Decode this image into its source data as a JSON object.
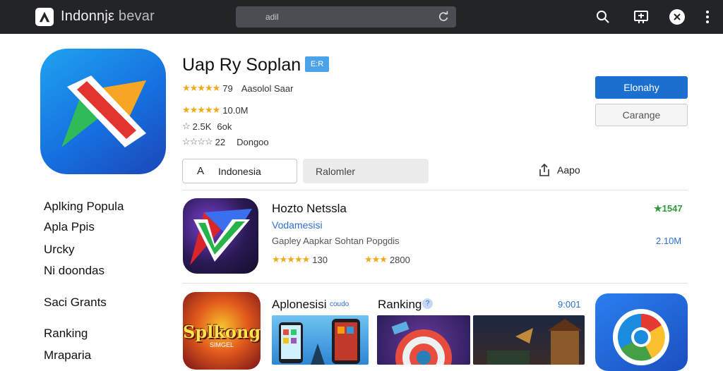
{
  "topbar": {
    "app_name_bold": "Indonnjε",
    "app_name_light": " bevar",
    "search_value": "adil",
    "icons": [
      "search-icon",
      "cast-icon",
      "profile-icon",
      "more-icon"
    ]
  },
  "hero": {
    "title": "Uap Ry Soplan",
    "badge": "E:R",
    "rating_line_1": {
      "stars": "★★★★★",
      "value": "79",
      "text": "Aasolol Saar"
    },
    "rating_line_2": {
      "stars": "★★★★★",
      "value": "10.0M"
    },
    "rating_line_3": {
      "stars": "☆",
      "value": "2.5K",
      "text": "6ok"
    },
    "rating_line_4": {
      "stars": "☆☆☆☆",
      "value": "22",
      "text": "Dongoo"
    },
    "primary_button": "Elonahy",
    "secondary_button": "Carange",
    "language_pill": "Indonesia",
    "language_glyph": "A",
    "ref_pill": "Ralomler",
    "share_label": "Aapo"
  },
  "sidebar": {
    "items": [
      "Aplking Popula",
      "Apla Ppis",
      "Urcky",
      "Ni doondas",
      "Saci Grants",
      "Ranking",
      "Mraparia"
    ]
  },
  "featured": {
    "title": "Hozto Netssla",
    "subtitle": "Vodamesisi",
    "description": "Gapley Aapkar Sohtan Popgdis",
    "rating_a": {
      "stars": "★★★★★",
      "value": "130"
    },
    "rating_b": {
      "stars": "★★★",
      "value": "2800"
    },
    "right_top": "★1547",
    "right_bottom": "2.10M"
  },
  "bottom": {
    "game_title": "Splkong",
    "game_subtitle": "SIMGEL",
    "section1_title": "Aplonesisi",
    "section1_tag": "coudo",
    "section2_title": "Ranking",
    "section2_badge": "?",
    "right_value": "9:001"
  },
  "colors": {
    "topbar": "#222427",
    "primary": "#1b6fce",
    "star_gold": "#f0a91b",
    "green": "#2e9a3a",
    "link_blue": "#2c6fcf"
  }
}
